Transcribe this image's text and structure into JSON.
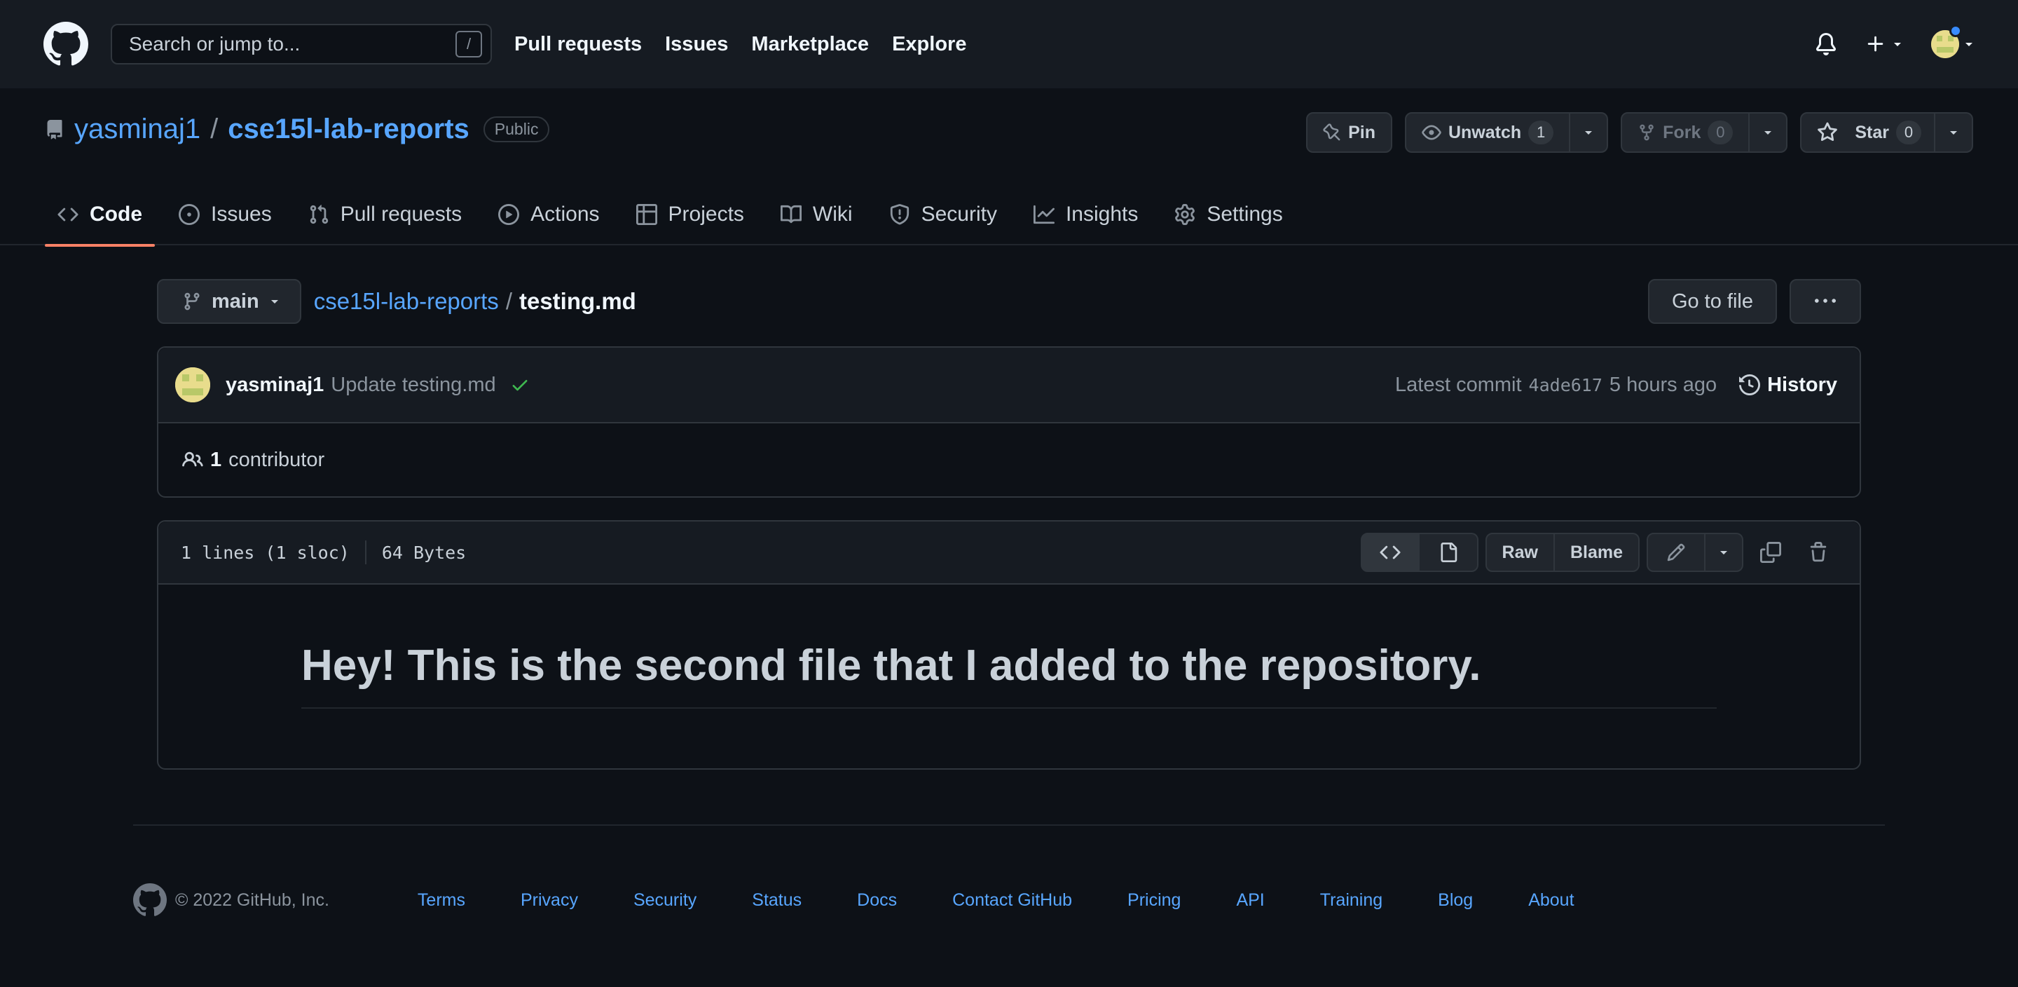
{
  "header": {
    "search_placeholder": "Search or jump to...",
    "search_key": "/",
    "nav": [
      "Pull requests",
      "Issues",
      "Marketplace",
      "Explore"
    ]
  },
  "repo": {
    "owner": "yasminaj1",
    "separator": "/",
    "name": "cse15l-lab-reports",
    "visibility": "Public",
    "pin_label": "Pin",
    "watch_label": "Unwatch",
    "watch_count": "1",
    "fork_label": "Fork",
    "fork_count": "0",
    "star_label": "Star",
    "star_count": "0"
  },
  "tabs": [
    {
      "label": "Code",
      "icon": "code-icon",
      "active": true
    },
    {
      "label": "Issues",
      "icon": "issue-icon"
    },
    {
      "label": "Pull requests",
      "icon": "pull-request-icon"
    },
    {
      "label": "Actions",
      "icon": "play-icon"
    },
    {
      "label": "Projects",
      "icon": "table-icon"
    },
    {
      "label": "Wiki",
      "icon": "book-icon"
    },
    {
      "label": "Security",
      "icon": "shield-icon"
    },
    {
      "label": "Insights",
      "icon": "graph-icon"
    },
    {
      "label": "Settings",
      "icon": "gear-icon"
    }
  ],
  "path": {
    "branch": "main",
    "repo_link": "cse15l-lab-reports",
    "slash": "/",
    "file": "testing.md",
    "go_to_file": "Go to file",
    "more": "···"
  },
  "commit": {
    "author": "yasminaj1",
    "message": "Update testing.md",
    "latest_label": "Latest commit",
    "sha": "4ade617",
    "time": "5 hours ago",
    "history_label": "History",
    "status_color": "#3fb950"
  },
  "contributors": {
    "count": "1",
    "label": "contributor"
  },
  "file": {
    "lines": "1 lines (1 sloc)",
    "size": "64 Bytes",
    "raw_label": "Raw",
    "blame_label": "Blame",
    "heading": "Hey! This is the second file that I added to the repository."
  },
  "footer": {
    "copyright": "© 2022 GitHub, Inc.",
    "links": [
      "Terms",
      "Privacy",
      "Security",
      "Status",
      "Docs",
      "Contact GitHub",
      "Pricing",
      "API",
      "Training",
      "Blog",
      "About"
    ]
  },
  "colors": {
    "background": "#0d1117",
    "header": "#161b22",
    "link": "#58a6ff",
    "tab_underline": "#f78166"
  }
}
